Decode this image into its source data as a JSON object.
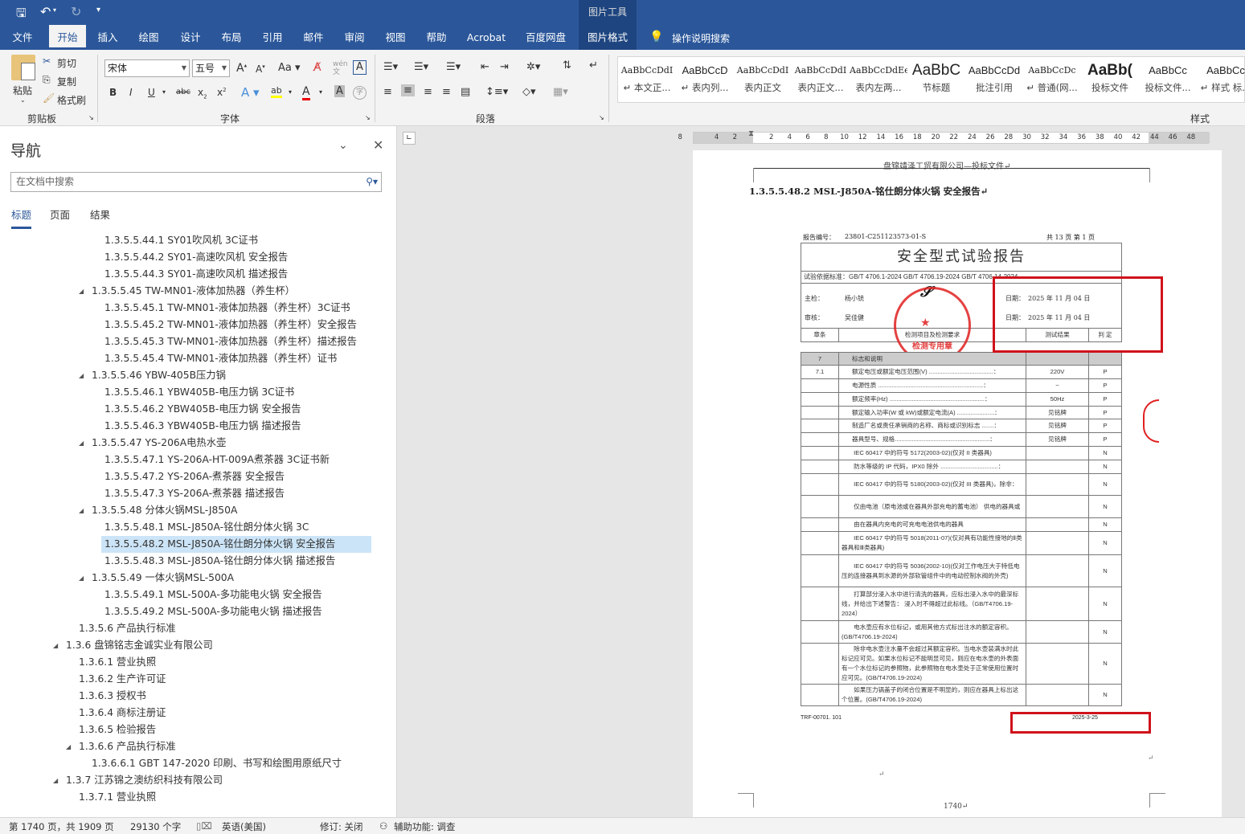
{
  "titlebar": {
    "context_tab_group": "图片工具"
  },
  "tabs": [
    "文件",
    "开始",
    "插入",
    "绘图",
    "设计",
    "布局",
    "引用",
    "邮件",
    "审阅",
    "视图",
    "帮助",
    "Acrobat",
    "百度网盘",
    "图片格式"
  ],
  "tell_me": "操作说明搜索",
  "ribbon": {
    "clipboard": {
      "paste": "粘贴",
      "cut": "剪切",
      "copy": "复制",
      "format_painter": "格式刷",
      "label": "剪贴板"
    },
    "font": {
      "name": "宋体",
      "size": "五号",
      "label": "字体"
    },
    "paragraph": {
      "label": "段落"
    },
    "styles": {
      "label": "样式",
      "items": [
        {
          "preview": "AaBbCcDdI",
          "name": "↵ 本文正..."
        },
        {
          "preview": "AaBbCcD",
          "name": "↵ 表内列..."
        },
        {
          "preview": "AaBbCcDdI",
          "name": "表内正文"
        },
        {
          "preview": "AaBbCcDdI",
          "name": "表内正文..."
        },
        {
          "preview": "AaBbCcDdEe",
          "name": "表内左两..."
        },
        {
          "preview": "AaBbC",
          "name": "节标题"
        },
        {
          "preview": "AaBbCcDd",
          "name": "批注引用"
        },
        {
          "preview": "AaBbCcDc",
          "name": "↵ 普通(网..."
        },
        {
          "preview": "AaBb(",
          "name": "投标文件"
        },
        {
          "preview": "AaBbCc",
          "name": "投标文件..."
        },
        {
          "preview": "AaBbCc",
          "name": "↵ 样式 标..."
        }
      ]
    }
  },
  "nav": {
    "title": "导航",
    "search_placeholder": "在文档中搜索",
    "tabs": [
      "标题",
      "页面",
      "结果"
    ],
    "items": [
      {
        "text": "1.3.5.5.44.1 SY01吹风机 3C证书",
        "level": 4
      },
      {
        "text": "1.3.5.5.44.2 SY01-高速吹风机 安全报告",
        "level": 4
      },
      {
        "text": "1.3.5.5.44.3 SY01-高速吹风机 描述报告",
        "level": 4
      },
      {
        "text": "1.3.5.5.45 TW-MN01-液体加热器（养生杯）",
        "level": 3,
        "expanded": true
      },
      {
        "text": "1.3.5.5.45.1 TW-MN01-液体加热器（养生杯）3C证书",
        "level": 4
      },
      {
        "text": "1.3.5.5.45.2 TW-MN01-液体加热器（养生杯）安全报告",
        "level": 4
      },
      {
        "text": "1.3.5.5.45.3 TW-MN01-液体加热器（养生杯）描述报告",
        "level": 4
      },
      {
        "text": "1.3.5.5.45.4 TW-MN01-液体加热器（养生杯）证书",
        "level": 4
      },
      {
        "text": "1.3.5.5.46 YBW-405B压力锅",
        "level": 3,
        "expanded": true
      },
      {
        "text": "1.3.5.5.46.1 YBW405B-电压力锅 3C证书",
        "level": 4
      },
      {
        "text": "1.3.5.5.46.2 YBW405B-电压力锅 安全报告",
        "level": 4
      },
      {
        "text": "1.3.5.5.46.3 YBW405B-电压力锅 描述报告",
        "level": 4
      },
      {
        "text": "1.3.5.5.47 YS-206A电热水壶",
        "level": 3,
        "expanded": true
      },
      {
        "text": "1.3.5.5.47.1 YS-206A-HT-009A煮茶器  3C证书新",
        "level": 4
      },
      {
        "text": "1.3.5.5.47.2 YS-206A-煮茶器 安全报告",
        "level": 4
      },
      {
        "text": "1.3.5.5.47.3 YS-206A-煮茶器 描述报告",
        "level": 4
      },
      {
        "text": "1.3.5.5.48 分体火锅MSL-J850A",
        "level": 3,
        "expanded": true
      },
      {
        "text": "1.3.5.5.48.1 MSL-J850A-铭仕朗分体火锅 3C",
        "level": 4
      },
      {
        "text": "1.3.5.5.48.2 MSL-J850A-铭仕朗分体火锅 安全报告",
        "level": 4,
        "selected": true
      },
      {
        "text": "1.3.5.5.48.3 MSL-J850A-铭仕朗分体火锅 描述报告",
        "level": 4
      },
      {
        "text": "1.3.5.5.49 一体火锅MSL-500A",
        "level": 3,
        "expanded": true
      },
      {
        "text": "1.3.5.5.49.1 MSL-500A-多功能电火锅 安全报告",
        "level": 4
      },
      {
        "text": "1.3.5.5.49.2 MSL-500A-多功能电火锅 描述报告",
        "level": 4
      },
      {
        "text": "1.3.5.6 产品执行标准",
        "level": 2
      },
      {
        "text": "1.3.6 盘锦铭志金诚实业有限公司",
        "level": 1,
        "expanded": true
      },
      {
        "text": "1.3.6.1 营业执照",
        "level": 2
      },
      {
        "text": "1.3.6.2 生产许可证",
        "level": 2
      },
      {
        "text": "1.3.6.3 授权书",
        "level": 2
      },
      {
        "text": "1.3.6.4 商标注册证",
        "level": 2
      },
      {
        "text": "1.3.6.5 检验报告",
        "level": 2
      },
      {
        "text": "1.3.6.6 产品执行标准",
        "level": 2,
        "expanded": true
      },
      {
        "text": "1.3.6.6.1 GBT 147-2020 印刷、书写和绘图用原纸尺寸",
        "level": 3
      },
      {
        "text": "1.3.7 江苏锦之澳纺织科技有限公司",
        "level": 1,
        "expanded": true
      },
      {
        "text": "1.3.7.1 营业执照",
        "level": 2
      }
    ]
  },
  "ruler": {
    "left": [
      8,
      4,
      2
    ],
    "right": [
      2,
      4,
      6,
      8,
      10,
      12,
      14,
      16,
      18,
      20,
      22,
      24,
      26,
      28,
      30,
      32,
      34,
      36,
      38,
      40,
      42,
      44,
      46,
      48
    ]
  },
  "document": {
    "header": "盘锦靖泽工贸有限公司—投标文件↵",
    "heading": "1.3.5.5.48.2  MSL-J850A-铭仕朗分体火锅 安全报告↵",
    "report": {
      "report_no_label": "报告编号：",
      "report_no": "23801-C251123573-01-S",
      "pages": "共   13   页 第   1   页",
      "title": "安全型式试验报告",
      "standard_label": "试验依据标准：",
      "standard": "GB/T 4706.1-2024   GB/T 4706.19-2024   GB/T 4706.14-2024",
      "inspector_label": "主检：",
      "inspector": "杨小铳",
      "reviewer_label": "审核：",
      "reviewer": "吴佳健",
      "date_label": "日期：",
      "date1": "2025 年 11 月 04 日",
      "date2": "2025 年 11 月 04 日",
      "col_clause": "章条",
      "col_item": "检测项目及检测要求",
      "col_result": "测试结果",
      "col_verdict": "判 定",
      "stamp_text": "检测专用章",
      "section": {
        "clause": "7",
        "title": "标志和说明"
      },
      "rows": [
        {
          "clause": "7.1",
          "item": "额定电压或额定电压范围(V) ......................................：",
          "result": "220V",
          "verdict": "P"
        },
        {
          "clause": "",
          "item": "电源性质 ..............................................................：",
          "result": "~",
          "verdict": "P"
        },
        {
          "clause": "",
          "item": "额定频率(Hz) ........................................................：",
          "result": "50Hz",
          "verdict": "P"
        },
        {
          "clause": "",
          "item": "额定输入功率(W 或 kW)或额定电流(A) ......................：",
          "result": "见铭牌",
          "verdict": "P"
        },
        {
          "clause": "",
          "item": "制造厂名或责任承销商的名称、商标或识别标志 .......：",
          "result": "见铭牌",
          "verdict": "P"
        },
        {
          "clause": "",
          "item": "器具型号、规格........................................................：",
          "result": "见铭牌",
          "verdict": "P"
        },
        {
          "clause": "",
          "item": "　　IEC 60417 中的符号 5172(2003-02)(仅对 II 类器具)",
          "result": "",
          "verdict": "N"
        },
        {
          "clause": "",
          "item": "　　防水等级的 IP 代码，IPX0 除外 ..................................：",
          "result": "",
          "verdict": "N"
        },
        {
          "clause": "",
          "item": "　　IEC 60417 中的符号 5180(2003-02)(仅对 III 类器具)，除非：",
          "result": "",
          "verdict": "N"
        },
        {
          "clause": "",
          "item": "　　仅由电池（原电池或在器具外部充电的蓄电池） 供电的器具或",
          "result": "",
          "verdict": "N"
        },
        {
          "clause": "",
          "item": "　　由在器具内充电的可充电电池供电的器具",
          "result": "",
          "verdict": "N"
        },
        {
          "clause": "",
          "item": "　　IEC 60417 中的符号 5018(2011-07)(仅对具有功能性接地的Ⅱ类器具和Ⅲ类器具)",
          "result": "",
          "verdict": "N"
        },
        {
          "clause": "",
          "item": "　　IEC 60417 中的符号 5036(2002-10)(仅对工作电压大于特低电压的连接器具到水源的外部软管组件中的电动控制水阀的外壳)",
          "result": "",
          "verdict": "N"
        },
        {
          "clause": "",
          "item": "　　打算部分浸入水中进行清洗的器具，应标出浸入水中的最深标线，并给出下述警告： 浸入时不得超过此标线。（GB/T4706.19-2024）",
          "result": "",
          "verdict": "N"
        },
        {
          "clause": "",
          "item": "　　电水壶应有水位标记，或用其他方式标出注水的额定容积。(GB/T4706.19-2024)",
          "result": "",
          "verdict": "N"
        },
        {
          "clause": "",
          "item": "　　除非电水壶注水量不会超过其额定容积。当电水壶装满水时此标记应可见。如果水位标记不能明显可见，则应在电水壶的外表面有一个水位标记的参照物，此参照物在电水壶处于正常使用位置时应可见。(GB/T4706.19-2024)",
          "result": "",
          "verdict": "N"
        },
        {
          "clause": "",
          "item": "　　如果压力锅盖子的闭合位置是不明显的，则应在器具上标出这个位置。(GB/T4706.19-2024)",
          "result": "",
          "verdict": "N"
        }
      ],
      "footer_left": "TRF-00701. 101",
      "footer_right": "2025-3-25"
    },
    "page_number": "1740↵",
    "para_mark": "↵"
  },
  "statusbar": {
    "page": "第 1740 页，共 1909 页",
    "words": "29130 个字",
    "language": "英语(美国)",
    "track_changes": "修订: 关闭",
    "accessibility": "辅助功能: 调查"
  },
  "colors": {
    "brand": "#2b579a",
    "highlight": "#cce4f7",
    "annotation_red": "#d0121b",
    "stamp_red": "#e02020"
  }
}
